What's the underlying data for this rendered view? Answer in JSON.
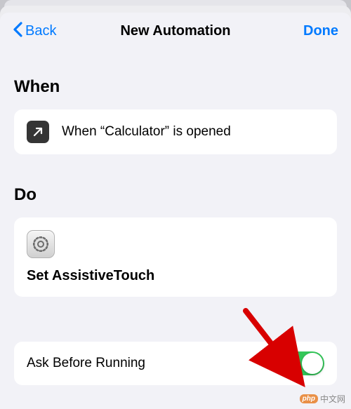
{
  "nav": {
    "back": "Back",
    "title": "New Automation",
    "done": "Done"
  },
  "sections": {
    "when": {
      "header": "When",
      "item": "When “Calculator” is opened"
    },
    "do": {
      "header": "Do",
      "action": "Set AssistiveTouch"
    },
    "ask": {
      "label": "Ask Before Running",
      "value": true
    }
  },
  "watermark": {
    "badge": "php",
    "text": "中文网"
  }
}
